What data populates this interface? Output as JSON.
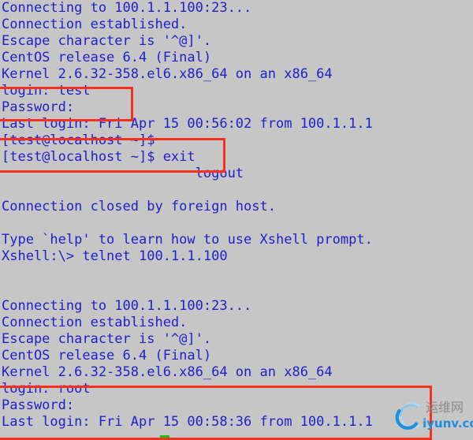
{
  "terminal": {
    "background_color": "#c6c6c6",
    "text_color": "#2020cc",
    "annotation_color": "#f4301f",
    "cursor_color": "#14c414",
    "lines": [
      "Connecting to 100.1.1.100:23...",
      "Connection established.",
      "Escape character is '^@]'.",
      "CentOS release 6.4 (Final)",
      "Kernel 2.6.32-358.el6.x86_64 on an x86_64",
      "login: test",
      "Password:",
      "Last login: Fri Apr 15 00:56:02 from 100.1.1.1",
      "[test@localhost ~]$",
      "[test@localhost ~]$ exit",
      "                        logout",
      "",
      "Connection closed by foreign host.",
      "",
      "Type `help' to learn how to use Xshell prompt.",
      "Xshell:\\> telnet 100.1.1.100",
      "",
      "",
      "Connecting to 100.1.1.100:23...",
      "Connection established.",
      "Escape character is '^@]'.",
      "CentOS release 6.4 (Final)",
      "Kernel 2.6.32-358.el6.x86_64 on an x86_64",
      "login: root",
      "Password:",
      "Last login: Fri Apr 15 00:58:36 from 100.1.1.1"
    ]
  },
  "annotations": [
    {
      "id": "annot-1",
      "label": "test-login-highlight"
    },
    {
      "id": "annot-2",
      "label": "test-prompt-exit-highlight"
    },
    {
      "id": "annot-3",
      "label": "root-login-highlight"
    }
  ],
  "watermark": {
    "chinese": "运维网",
    "domain": "iyunv.com",
    "logo_color": "#1e90e0"
  }
}
